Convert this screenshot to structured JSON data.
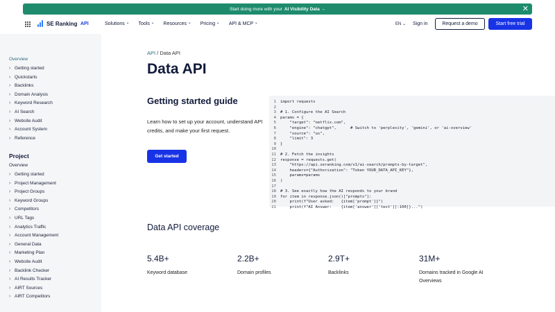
{
  "banner": {
    "text": "Start doing more with your",
    "highlight": "AI Visibility Data →",
    "close": "✕"
  },
  "nav": {
    "logo": "SE Ranking",
    "api": "API",
    "menu": [
      "Solutions",
      "Tools",
      "Resources",
      "Pricing",
      "API & MCP"
    ],
    "lang": "EN ⌄",
    "signin": "Sign in",
    "demo": "Request a demo",
    "trial": "Start free trial"
  },
  "sidebar": {
    "overview": "Overview",
    "items": [
      "Getting started",
      "Quickstarts",
      "Backlinks",
      "Domain Analysis",
      "Keyword Research",
      "AI Search",
      "Website Audit",
      "Account System",
      "Reference"
    ],
    "project_head": "Project",
    "project_overview": "Overview",
    "project_items": [
      "Getting started",
      "Project Management",
      "Project Groups",
      "Keyword Groups",
      "Competitors",
      "URL Tags",
      "Analytics Traffic",
      "Account Management",
      "General Data",
      "Marketing Plan",
      "Website Audit",
      "Backlink Checker",
      "AI Results Tracker",
      "AIRT Sources",
      "AIRT Competitors"
    ]
  },
  "main": {
    "crumb_link": "API",
    "crumb_sep": " / ",
    "crumb_current": "Data API",
    "title": "Data API",
    "guide_title": "Getting started guide",
    "guide_desc": "Learn how to set up your account, understand API credits, and make your first request.",
    "start_button": "Get started",
    "coverage_title": "Data API coverage",
    "stats": [
      {
        "value": "5.4B+",
        "label": "Keyword database"
      },
      {
        "value": "2.2B+",
        "label": "Domain profiles"
      },
      {
        "value": "2.9T+",
        "label": "Backlinks"
      },
      {
        "value": "31M+",
        "label": "Domains tracked in Google AI Overviews"
      }
    ]
  },
  "code": {
    "lines": [
      {
        "n": "1",
        "t": "import requests"
      },
      {
        "n": "2",
        "t": ""
      },
      {
        "n": "3",
        "t": "# 1. Configure the AI Search"
      },
      {
        "n": "4",
        "t": "params = {"
      },
      {
        "n": "5",
        "t": "    \"target\": \"netflix.com\","
      },
      {
        "n": "6",
        "t": "    \"engine\": \"chatgpt\",      # Switch to 'perplexity', 'gemini', or 'ai-overview'"
      },
      {
        "n": "7",
        "t": "    \"source\": \"us\","
      },
      {
        "n": "8",
        "t": "    \"limit\": 3"
      },
      {
        "n": "9",
        "t": "}"
      },
      {
        "n": "10",
        "t": ""
      },
      {
        "n": "11",
        "t": "# 2. Fetch the insights"
      },
      {
        "n": "12",
        "t": "response = requests.get("
      },
      {
        "n": "13",
        "t": "    \"https://api.seranking.com/v1/ai-search/prompts-by-target\","
      },
      {
        "n": "14",
        "t": "    headers={\"Authorization\": \"Token YOUR_DATA_API_KEY\"},"
      },
      {
        "n": "15",
        "t": "    params=params"
      },
      {
        "n": "16",
        "t": ")"
      },
      {
        "n": "17",
        "t": ""
      },
      {
        "n": "18",
        "t": "# 3. See exactly how the AI responds to your brand"
      },
      {
        "n": "19",
        "t": "for item in response.json()[\"prompts\"]:"
      },
      {
        "n": "20",
        "t": "    print(f\"User asked:   {item['prompt']}\")"
      },
      {
        "n": "21",
        "t": "    print(f\"AI Answer:    {item['answer']['text'][:100]}...\")"
      }
    ]
  }
}
